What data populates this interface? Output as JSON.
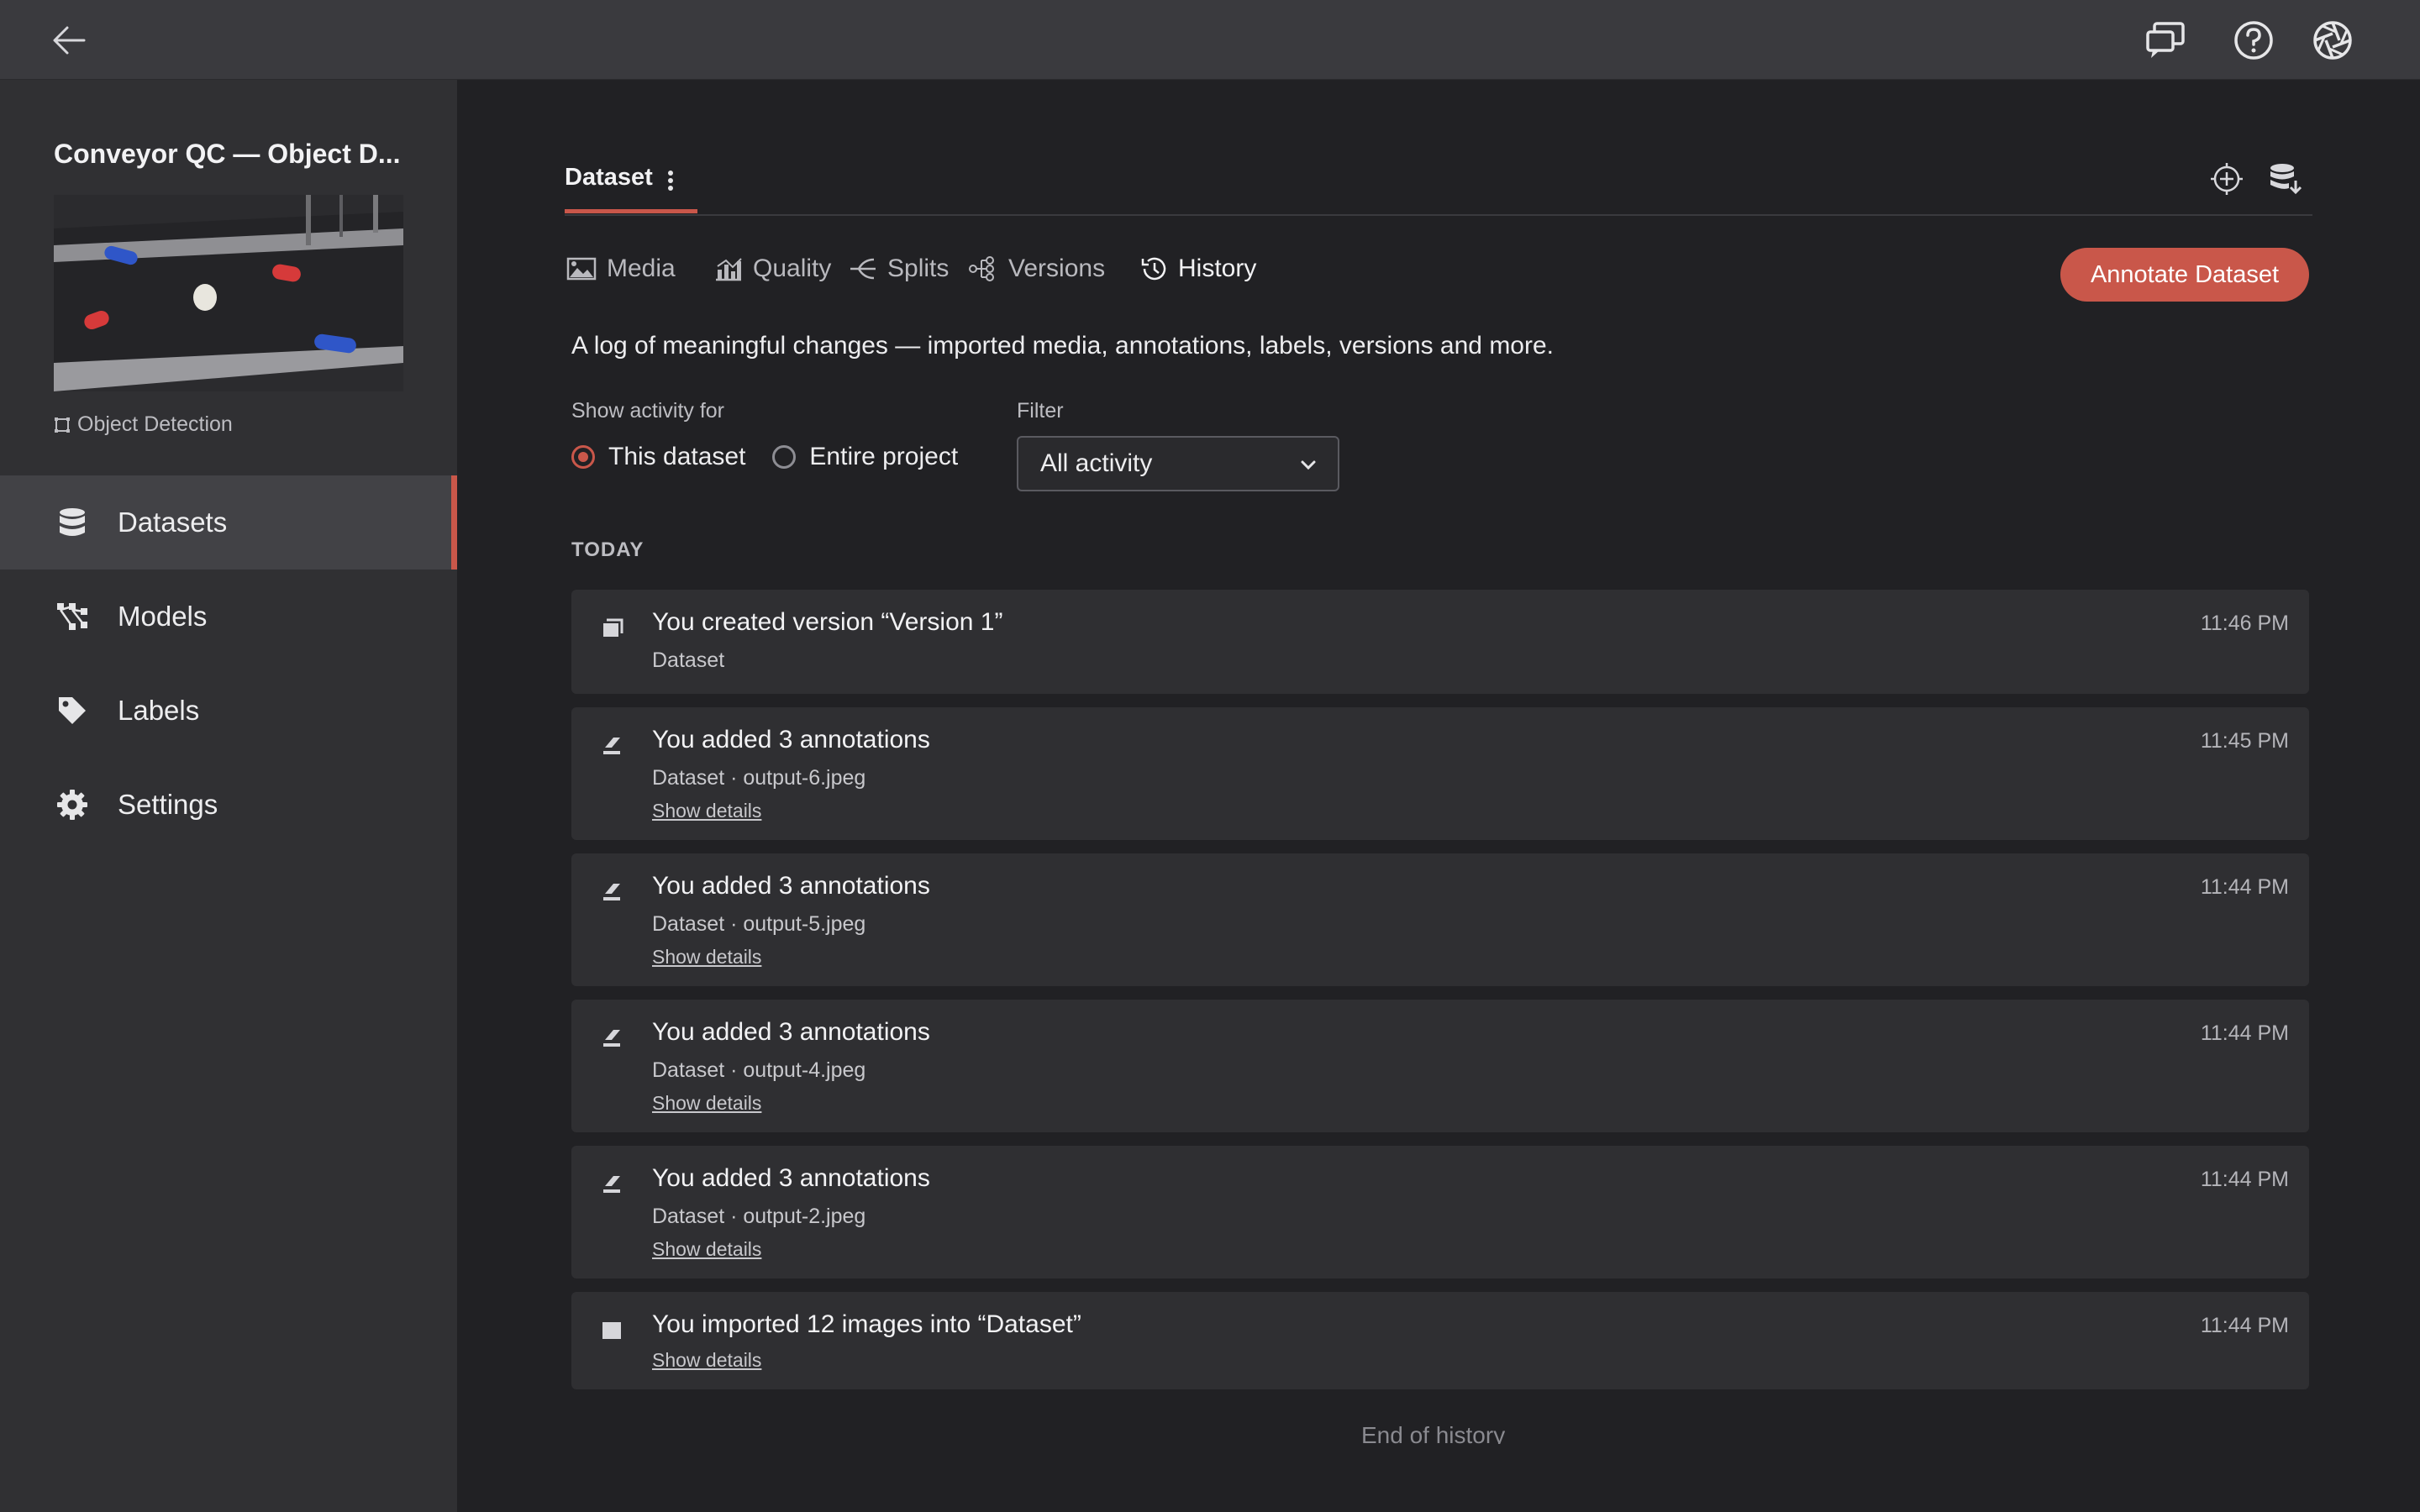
{
  "topbar": {
    "back_icon": "arrow-left-icon",
    "icons": [
      "chat-icon",
      "help-icon",
      "aperture-icon"
    ]
  },
  "sidebar": {
    "project_title": "Conveyor QC — Object D...",
    "project_type": "Object Detection",
    "items": [
      {
        "label": "Datasets",
        "icon": "database-icon",
        "active": true
      },
      {
        "label": "Models",
        "icon": "model-icon",
        "active": false
      },
      {
        "label": "Labels",
        "icon": "tag-icon",
        "active": false
      },
      {
        "label": "Settings",
        "icon": "gear-icon",
        "active": false
      }
    ]
  },
  "main": {
    "dataset_tab": "Dataset",
    "subtabs": [
      {
        "label": "Media",
        "icon": "image-icon"
      },
      {
        "label": "Quality",
        "icon": "chart-icon"
      },
      {
        "label": "Splits",
        "icon": "split-icon"
      },
      {
        "label": "Versions",
        "icon": "versions-icon"
      },
      {
        "label": "History",
        "icon": "history-icon",
        "active": true
      }
    ],
    "annotate_button": "Annotate Dataset",
    "description": "A log of meaningful changes — imported media, annotations, labels, versions and more.",
    "show_activity_label": "Show activity for",
    "radio_options": [
      {
        "label": "This dataset",
        "selected": true
      },
      {
        "label": "Entire project",
        "selected": false
      }
    ],
    "filter_label": "Filter",
    "filter_value": "All activity",
    "section_header": "TODAY",
    "entries": [
      {
        "title": "You created version “Version 1”",
        "subtitle": "Dataset",
        "link": "",
        "time": "11:46 PM",
        "icon": "version-icon"
      },
      {
        "title": "You added 3 annotations",
        "subtitle": "Dataset · output-6.jpeg",
        "link": "Show details",
        "time": "11:45 PM",
        "icon": "annotation-icon"
      },
      {
        "title": "You added 3 annotations",
        "subtitle": "Dataset · output-5.jpeg",
        "link": "Show details",
        "time": "11:44 PM",
        "icon": "annotation-icon"
      },
      {
        "title": "You added 3 annotations",
        "subtitle": "Dataset · output-4.jpeg",
        "link": "Show details",
        "time": "11:44 PM",
        "icon": "annotation-icon"
      },
      {
        "title": "You added 3 annotations",
        "subtitle": "Dataset · output-2.jpeg",
        "link": "Show details",
        "time": "11:44 PM",
        "icon": "annotation-icon"
      },
      {
        "title": "You imported 12 images into “Dataset”",
        "subtitle": "",
        "link": "Show details",
        "time": "11:44 PM",
        "icon": "import-icon"
      }
    ],
    "end_text": "End of history"
  },
  "colors": {
    "accent": "#c9574a",
    "background": "#212124",
    "sidebar": "#303033",
    "card": "#2f2f32"
  }
}
